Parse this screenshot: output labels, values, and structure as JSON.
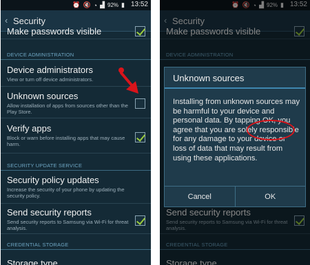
{
  "status_bar": {
    "battery": "92%",
    "time": "13:52"
  },
  "action_bar": {
    "title": "Security"
  },
  "settings": {
    "make_passwords_visible": "Make passwords visible",
    "device_admin_header": "DEVICE ADMINISTRATION",
    "device_administrators_title": "Device administrators",
    "device_administrators_sub": "View or turn off device administrators.",
    "unknown_sources_title": "Unknown sources",
    "unknown_sources_sub": "Allow installation of apps from sources other than the Play Store.",
    "verify_apps_title": "Verify apps",
    "verify_apps_sub": "Block or warn before installing apps that may cause harm.",
    "security_update_header": "SECURITY UPDATE SERVICE",
    "security_policy_title": "Security policy updates",
    "security_policy_sub": "Increase the security of your phone by updating the security policy.",
    "send_reports_title": "Send security reports",
    "send_reports_sub": "Send security reports to Samsung via Wi-Fi for threat analysis.",
    "credential_storage_header": "CREDENTIAL STORAGE",
    "storage_type_title": "Storage type"
  },
  "dialog": {
    "title": "Unknown sources",
    "message": "Installing from unknown sources may be harmful to your device and personal data. By tapping OK, you agree that you are solely responsible for any damage to your device or loss of data that may result from using these applications.",
    "cancel_label": "Cancel",
    "ok_label": "OK"
  },
  "colors": {
    "annotation_red": "#d9141b",
    "checkmark_green": "#9ccc3e",
    "background": "#142a36",
    "section_header": "#6fa7c4"
  },
  "icons": [
    "back-chevron-icon",
    "alarm-icon",
    "mute-icon",
    "wifi-icon",
    "signal-icon",
    "battery-icon"
  ]
}
